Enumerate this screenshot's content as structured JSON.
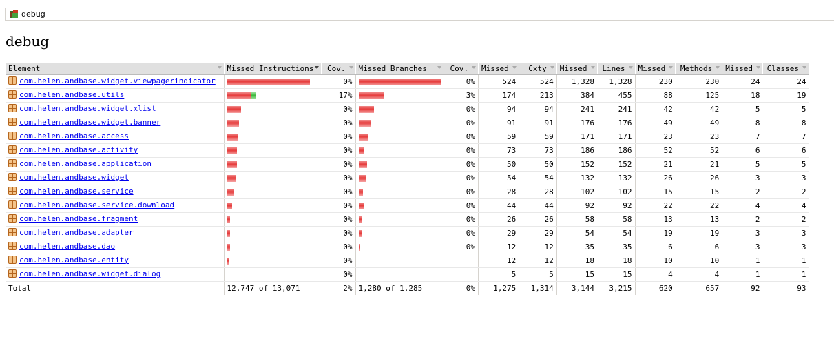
{
  "breadcrumb": {
    "label": "debug"
  },
  "page": {
    "title": "debug"
  },
  "table": {
    "headers": [
      "Element",
      "Missed Instructions",
      "Cov.",
      "Missed Branches",
      "Cov.",
      "Missed",
      "Cxty",
      "Missed",
      "Lines",
      "Missed",
      "Methods",
      "Missed",
      "Classes"
    ],
    "rows": [
      {
        "name": "com.helen.andbase.widget.viewpagerindicator",
        "instr_missed": 1.0,
        "instr_cov": "0%",
        "br_missed": 1.0,
        "br_covered": 0.0,
        "br_cov": "0%",
        "cx_missed": "524",
        "cxty": "524",
        "ln_missed": "1,328",
        "lines": "1,328",
        "mt_missed": "230",
        "methods": "230",
        "cl_missed": "24",
        "classes": "24"
      },
      {
        "name": "com.helen.andbase.utils",
        "instr_missed": 0.29,
        "instr_covered": 0.06,
        "instr_cov": "17%",
        "br_missed": 0.3,
        "br_covered": 0.0,
        "br_cov": "3%",
        "cx_missed": "174",
        "cxty": "213",
        "ln_missed": "384",
        "lines": "455",
        "mt_missed": "88",
        "methods": "125",
        "cl_missed": "18",
        "classes": "19"
      },
      {
        "name": "com.helen.andbase.widget.xlist",
        "instr_missed": 0.17,
        "instr_cov": "0%",
        "br_missed": 0.18,
        "br_cov": "0%",
        "cx_missed": "94",
        "cxty": "94",
        "ln_missed": "241",
        "lines": "241",
        "mt_missed": "42",
        "methods": "42",
        "cl_missed": "5",
        "classes": "5"
      },
      {
        "name": "com.helen.andbase.widget.banner",
        "instr_missed": 0.14,
        "instr_cov": "0%",
        "br_missed": 0.15,
        "br_cov": "0%",
        "cx_missed": "91",
        "cxty": "91",
        "ln_missed": "176",
        "lines": "176",
        "mt_missed": "49",
        "methods": "49",
        "cl_missed": "8",
        "classes": "8"
      },
      {
        "name": "com.helen.andbase.access",
        "instr_missed": 0.13,
        "instr_cov": "0%",
        "br_missed": 0.12,
        "br_cov": "0%",
        "cx_missed": "59",
        "cxty": "59",
        "ln_missed": "171",
        "lines": "171",
        "mt_missed": "23",
        "methods": "23",
        "cl_missed": "7",
        "classes": "7"
      },
      {
        "name": "com.helen.andbase.activity",
        "instr_missed": 0.12,
        "instr_cov": "0%",
        "br_missed": 0.07,
        "br_cov": "0%",
        "cx_missed": "73",
        "cxty": "73",
        "ln_missed": "186",
        "lines": "186",
        "mt_missed": "52",
        "methods": "52",
        "cl_missed": "6",
        "classes": "6"
      },
      {
        "name": "com.helen.andbase.application",
        "instr_missed": 0.12,
        "instr_cov": "0%",
        "br_missed": 0.1,
        "br_cov": "0%",
        "cx_missed": "50",
        "cxty": "50",
        "ln_missed": "152",
        "lines": "152",
        "mt_missed": "21",
        "methods": "21",
        "cl_missed": "5",
        "classes": "5"
      },
      {
        "name": "com.helen.andbase.widget",
        "instr_missed": 0.11,
        "instr_cov": "0%",
        "br_missed": 0.09,
        "br_cov": "0%",
        "cx_missed": "54",
        "cxty": "54",
        "ln_missed": "132",
        "lines": "132",
        "mt_missed": "26",
        "methods": "26",
        "cl_missed": "3",
        "classes": "3"
      },
      {
        "name": "com.helen.andbase.service",
        "instr_missed": 0.08,
        "instr_cov": "0%",
        "br_missed": 0.05,
        "br_cov": "0%",
        "cx_missed": "28",
        "cxty": "28",
        "ln_missed": "102",
        "lines": "102",
        "mt_missed": "15",
        "methods": "15",
        "cl_missed": "2",
        "classes": "2"
      },
      {
        "name": "com.helen.andbase.service.download",
        "instr_missed": 0.06,
        "instr_cov": "0%",
        "br_missed": 0.07,
        "br_cov": "0%",
        "cx_missed": "44",
        "cxty": "44",
        "ln_missed": "92",
        "lines": "92",
        "mt_missed": "22",
        "methods": "22",
        "cl_missed": "4",
        "classes": "4"
      },
      {
        "name": "com.helen.andbase.fragment",
        "instr_missed": 0.035,
        "instr_cov": "0%",
        "br_missed": 0.04,
        "br_cov": "0%",
        "cx_missed": "26",
        "cxty": "26",
        "ln_missed": "58",
        "lines": "58",
        "mt_missed": "13",
        "methods": "13",
        "cl_missed": "2",
        "classes": "2"
      },
      {
        "name": "com.helen.andbase.adapter",
        "instr_missed": 0.035,
        "instr_cov": "0%",
        "br_missed": 0.03,
        "br_cov": "0%",
        "cx_missed": "29",
        "cxty": "29",
        "ln_missed": "54",
        "lines": "54",
        "mt_missed": "19",
        "methods": "19",
        "cl_missed": "3",
        "classes": "3"
      },
      {
        "name": "com.helen.andbase.dao",
        "instr_missed": 0.03,
        "instr_cov": "0%",
        "br_missed": 0.015,
        "br_cov": "0%",
        "cx_missed": "12",
        "cxty": "12",
        "ln_missed": "35",
        "lines": "35",
        "mt_missed": "6",
        "methods": "6",
        "cl_missed": "3",
        "classes": "3"
      },
      {
        "name": "com.helen.andbase.entity",
        "instr_missed": 0.01,
        "instr_cov": "0%",
        "br_missed": 0,
        "br_cov": "",
        "cx_missed": "12",
        "cxty": "12",
        "ln_missed": "18",
        "lines": "18",
        "mt_missed": "10",
        "methods": "10",
        "cl_missed": "1",
        "classes": "1"
      },
      {
        "name": "com.helen.andbase.widget.dialog",
        "instr_missed": 0,
        "instr_cov": "0%",
        "br_missed": 0,
        "br_cov": "",
        "cx_missed": "5",
        "cxty": "5",
        "ln_missed": "15",
        "lines": "15",
        "mt_missed": "4",
        "methods": "4",
        "cl_missed": "1",
        "classes": "1"
      }
    ],
    "total": {
      "label": "Total",
      "instr": "12,747 of 13,071",
      "instr_cov": "2%",
      "br": "1,280 of 1,285",
      "br_cov": "0%",
      "cx_missed": "1,275",
      "cxty": "1,314",
      "ln_missed": "3,144",
      "lines": "3,215",
      "mt_missed": "620",
      "methods": "657",
      "cl_missed": "92",
      "classes": "93"
    }
  },
  "colors": {
    "missed": "#e63b3b",
    "covered": "#3cb83c",
    "link": "#0000ee",
    "header_bg": "#e0e0e0"
  },
  "icons": {
    "breadcrumb": "session-report-icon",
    "package": "package-icon"
  }
}
